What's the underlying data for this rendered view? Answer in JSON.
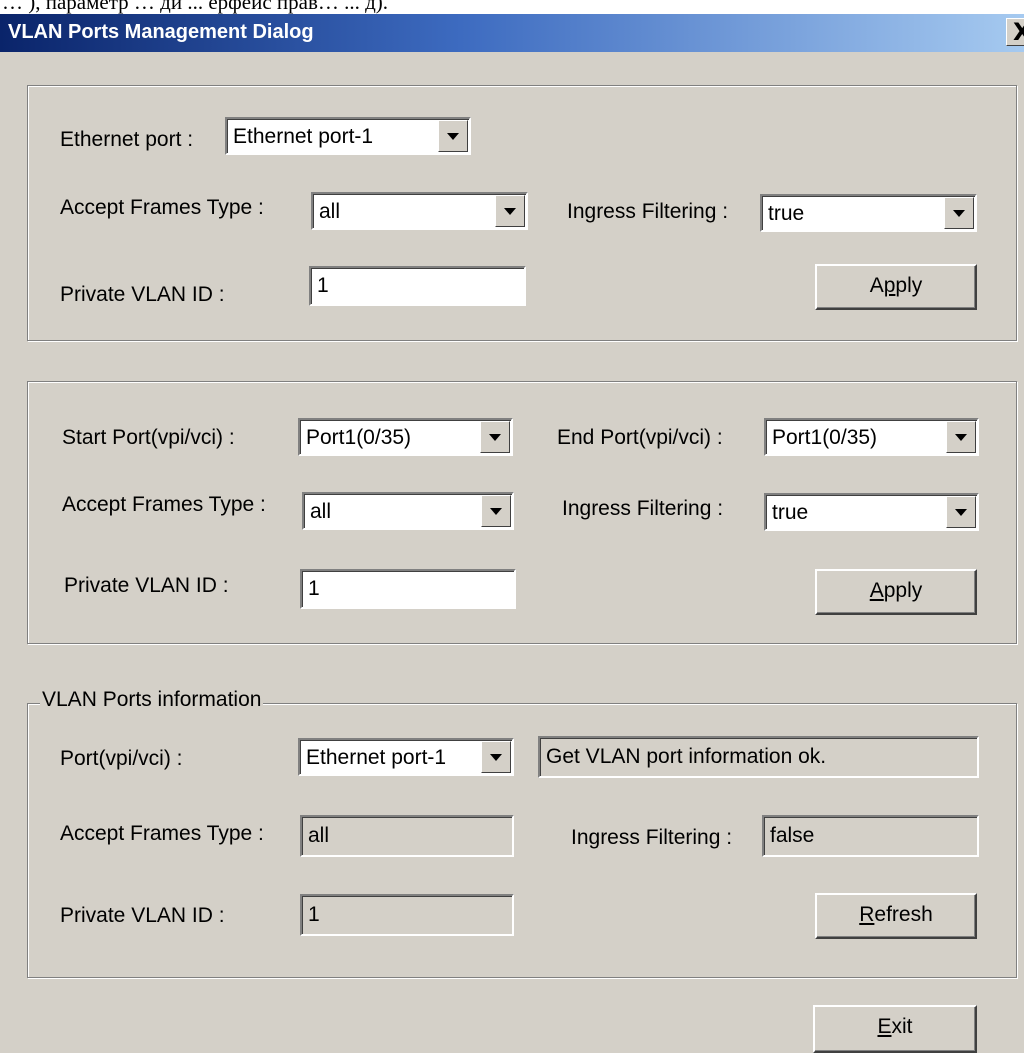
{
  "top_strip_text": "… ), параметр … ди ... ерфейс прав… ... д).",
  "window": {
    "title": "VLAN Ports Management Dialog",
    "close_label": "X"
  },
  "group1": {
    "ethernet_port_label": "Ethernet port :",
    "ethernet_port_value": "Ethernet port-1",
    "accept_frames_label": "Accept Frames Type :",
    "accept_frames_value": "all",
    "ingress_label": "Ingress Filtering :",
    "ingress_value": "true",
    "pvid_label": "Private VLAN ID :",
    "pvid_value": "1",
    "apply_button": {
      "pre": "A",
      "u": "p",
      "post": "ply"
    }
  },
  "group2": {
    "start_port_label": "Start Port(vpi/vci) :",
    "start_port_value": "Port1(0/35)",
    "end_port_label": "End Port(vpi/vci) :",
    "end_port_value": "Port1(0/35)",
    "accept_frames_label": "Accept Frames Type :",
    "accept_frames_value": "all",
    "ingress_label": "Ingress Filtering :",
    "ingress_value": "true",
    "pvid_label": "Private VLAN ID :",
    "pvid_value": "1",
    "apply_button": {
      "pre": "",
      "u": "A",
      "post": "pply"
    }
  },
  "group3": {
    "legend": "VLAN Ports information",
    "port_label": "Port(vpi/vci) :",
    "port_value": "Ethernet port-1",
    "status_text": "Get VLAN port information ok.",
    "accept_frames_label": "Accept Frames Type :",
    "accept_frames_value": "all",
    "ingress_label": "Ingress Filtering :",
    "ingress_value": "false",
    "pvid_label": "Private VLAN ID :",
    "pvid_value": "1",
    "refresh_button": {
      "pre": "",
      "u": "R",
      "post": "efresh"
    }
  },
  "exit_button": {
    "pre": "",
    "u": "E",
    "post": "xit"
  }
}
